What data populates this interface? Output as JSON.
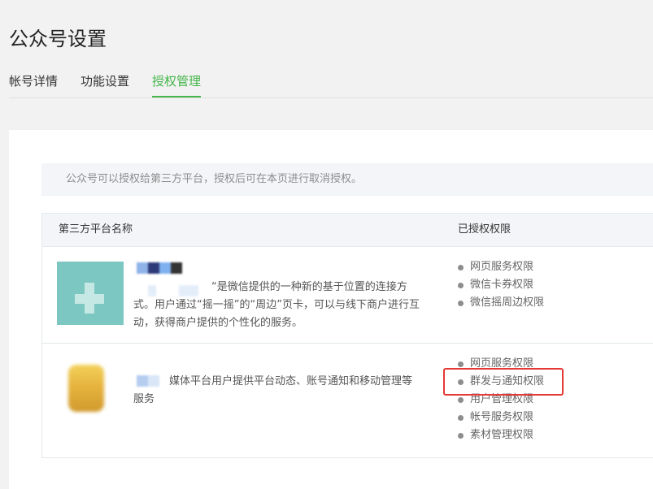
{
  "page": {
    "title": "公众号设置"
  },
  "tabs": [
    {
      "label": "帐号详情",
      "active": false
    },
    {
      "label": "功能设置",
      "active": false
    },
    {
      "label": "授权管理",
      "active": true
    }
  ],
  "notice": "公众号可以授权给第三方平台，授权后可在本页进行取消授权。",
  "table": {
    "headers": {
      "name": "第三方平台名称",
      "permissions": "已授权权限"
    },
    "rows": [
      {
        "description": "“是微信提供的一种新的基于位置的连接方式。用户通过“摇一摇”的“周边”页卡，可以与线下商户进行互动，获得商户提供的个性化的服务。",
        "permissions": [
          "网页服务权限",
          "微信卡券权限",
          "微信摇周边权限"
        ]
      },
      {
        "description": "媒体平台用户提供平台动态、账号通知和移动管理等服务",
        "permissions": [
          "网页服务权限",
          "群发与通知权限",
          "用户管理权限",
          "帐号服务权限",
          "素材管理权限"
        ]
      }
    ]
  },
  "colors": {
    "accent": "#44b549",
    "highlight": "#e53935"
  }
}
